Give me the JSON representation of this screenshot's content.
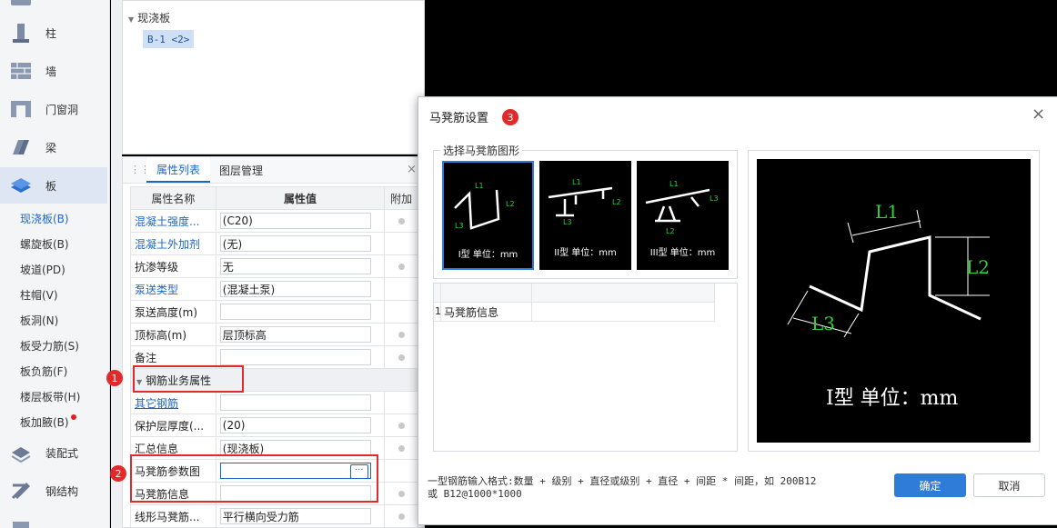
{
  "sidebar": {
    "categories": [
      {
        "label": "柱",
        "icon": "column-icon"
      },
      {
        "label": "墙",
        "icon": "wall-icon"
      },
      {
        "label": "门窗洞",
        "icon": "door-window-icon"
      },
      {
        "label": "梁",
        "icon": "beam-icon"
      },
      {
        "label": "板",
        "icon": "slab-icon"
      }
    ],
    "sub_items": [
      "现浇板(B)",
      "螺旋板(B)",
      "坡道(PD)",
      "柱帽(V)",
      "板洞(N)",
      "板受力筋(S)",
      "板负筋(F)",
      "楼层板带(H)",
      "板加腋(B)"
    ],
    "more": [
      {
        "label": "装配式",
        "icon": "prefab-icon"
      },
      {
        "label": "钢结构",
        "icon": "steel-structure-icon"
      }
    ]
  },
  "tree": {
    "group": "现浇板",
    "item": "B-1 <2>"
  },
  "props": {
    "tabs": [
      "属性列表",
      "图层管理"
    ],
    "headers": [
      "属性名称",
      "属性值",
      "附加"
    ],
    "rows": [
      {
        "name": "混凝土强度...",
        "value": "(C20)"
      },
      {
        "name": "混凝土外加剂",
        "value": "(无)"
      },
      {
        "name": "抗渗等级",
        "value": "无"
      },
      {
        "name": "泵送类型",
        "value": "(混凝土泵)"
      },
      {
        "name": "泵送高度(m)",
        "value": ""
      },
      {
        "name": "顶标高(m)",
        "value": "层顶标高"
      },
      {
        "name": "备注",
        "value": ""
      }
    ],
    "section": "钢筋业务属性",
    "rows2": [
      {
        "name": "其它钢筋",
        "value": ""
      },
      {
        "name": "保护层厚度(...",
        "value": "(20)"
      },
      {
        "name": "汇总信息",
        "value": "(现浇板)"
      },
      {
        "name": "马凳筋参数图",
        "value": ""
      },
      {
        "name": "马凳筋信息",
        "value": ""
      },
      {
        "name": "线形马凳筋...",
        "value": "平行横向受力筋"
      }
    ],
    "badges": [
      "1",
      "2"
    ],
    "ellipsis": "···"
  },
  "dialog": {
    "title": "马凳筋设置",
    "badge": "3",
    "group_label": "选择马凳筋图形",
    "shapes": [
      {
        "caption": "I型 单位：mm"
      },
      {
        "caption": "II型 单位：mm"
      },
      {
        "caption": "III型 单位：mm"
      }
    ],
    "table": {
      "row_num": "1",
      "row_label": "马凳筋信息"
    },
    "preview": {
      "l1": "L1",
      "l2": "L2",
      "l3": "L3",
      "caption": "I型 单位：mm"
    },
    "hint_line1": "一型钢筋输入格式:数量 + 级别 + 直径或级别 + 直径 + 间距 * 间距，如 200B12",
    "hint_line2": "或 B12@1000*1000",
    "ok": "确定",
    "cancel": "取消",
    "close": "×"
  },
  "colors": {
    "accent": "#1b67c9",
    "highlight": "#e22a2a",
    "cad_green": "#2fd13a"
  }
}
